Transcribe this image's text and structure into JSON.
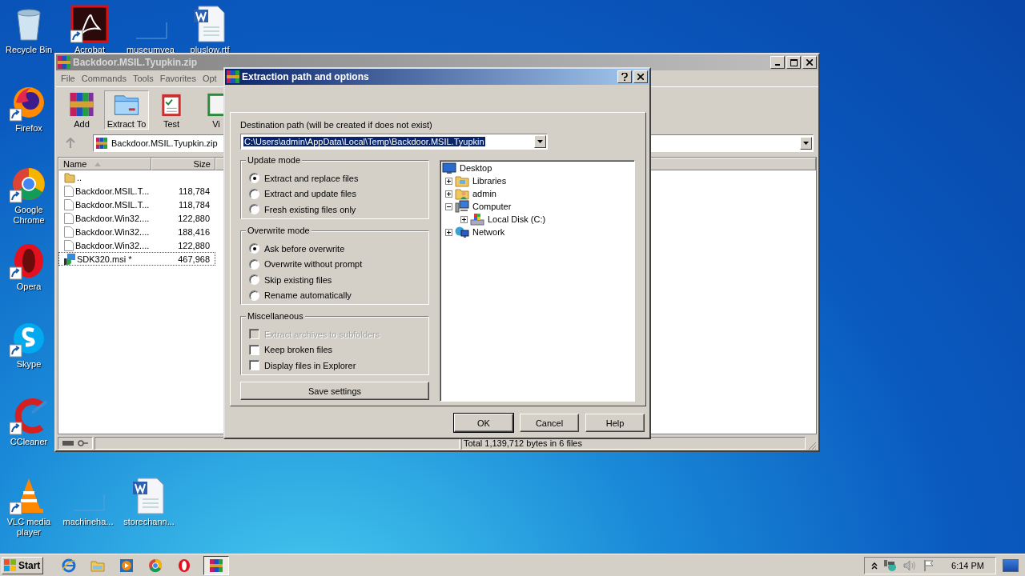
{
  "desktop_icons": [
    {
      "label": "Recycle Bin",
      "shortcut": false
    },
    {
      "label": "Acrobat",
      "shortcut": true
    },
    {
      "label": "museumvea",
      "shortcut": false
    },
    {
      "label": "pluslow.rtf",
      "shortcut": false
    },
    {
      "label": "Firefox",
      "shortcut": true
    },
    {
      "label": "Google Chrome",
      "shortcut": true
    },
    {
      "label": "Opera",
      "shortcut": true
    },
    {
      "label": "Skype",
      "shortcut": true
    },
    {
      "label": "CCleaner",
      "shortcut": true
    },
    {
      "label": "VLC media player",
      "shortcut": true
    },
    {
      "label": "machineha...",
      "shortcut": false
    },
    {
      "label": "storechann...",
      "shortcut": false
    }
  ],
  "archive_window": {
    "title": "Backdoor.MSIL.Tyupkin.zip",
    "menu": [
      "File",
      "Commands",
      "Tools",
      "Favorites",
      "Opt"
    ],
    "toolbar": [
      {
        "label": "Add",
        "selected": false
      },
      {
        "label": "Extract To",
        "selected": true
      },
      {
        "label": "Test",
        "selected": false
      },
      {
        "label": "Vi",
        "selected": false
      }
    ],
    "address": "Backdoor.MSIL.Tyupkin.zip",
    "columns": [
      "Name",
      "Size"
    ],
    "files": [
      {
        "kind": "folder",
        "name": "..",
        "focused": false
      },
      {
        "kind": "file",
        "name": "Backdoor.MSIL.T...",
        "size": "118,784",
        "focused": false
      },
      {
        "kind": "file",
        "name": "Backdoor.MSIL.T...",
        "size": "118,784",
        "focused": false
      },
      {
        "kind": "file",
        "name": "Backdoor.Win32....",
        "size": "122,880",
        "focused": false
      },
      {
        "kind": "file",
        "name": "Backdoor.Win32....",
        "size": "188,416",
        "focused": false
      },
      {
        "kind": "file",
        "name": "Backdoor.Win32....",
        "size": "122,880",
        "focused": false
      },
      {
        "kind": "installer",
        "name": "SDK320.msi *",
        "size": "467,968",
        "focused": true
      }
    ],
    "status_bar": "Total 1,139,712 bytes in 6 files"
  },
  "dialog": {
    "title": "Extraction path and options",
    "destination_label": "Destination path (will be created if does not exist)",
    "destination_value": "C:\\Users\\admin\\AppData\\Local\\Temp\\Backdoor.MSIL.Tyupkin",
    "update_mode": {
      "title": "Update mode",
      "options": [
        {
          "label": "Extract and replace files",
          "selected": true
        },
        {
          "label": "Extract and update files",
          "selected": false
        },
        {
          "label": "Fresh existing files only",
          "selected": false
        }
      ]
    },
    "overwrite_mode": {
      "title": "Overwrite mode",
      "options": [
        {
          "label": "Ask before overwrite",
          "selected": true
        },
        {
          "label": "Overwrite without prompt",
          "selected": false
        },
        {
          "label": "Skip existing files",
          "selected": false
        },
        {
          "label": "Rename automatically",
          "selected": false
        }
      ]
    },
    "miscellaneous": {
      "title": "Miscellaneous",
      "options": [
        {
          "label": "Extract archives to subfolders",
          "checked": false,
          "disabled": true
        },
        {
          "label": "Keep broken files",
          "checked": false,
          "disabled": false
        },
        {
          "label": "Display files in Explorer",
          "checked": false,
          "disabled": false
        }
      ]
    },
    "save_button": "Save settings",
    "tree": [
      {
        "label": "Desktop",
        "kind": "desktop",
        "children": [
          {
            "label": "Libraries",
            "kind": "libraries",
            "expanded": false
          },
          {
            "label": "admin",
            "kind": "user",
            "expanded": false
          },
          {
            "label": "Computer",
            "kind": "computer",
            "expanded": true,
            "children": [
              {
                "label": "Local Disk (C:)",
                "kind": "disk",
                "expanded": false
              }
            ]
          },
          {
            "label": "Network",
            "kind": "network",
            "expanded": false
          }
        ]
      }
    ],
    "buttons": [
      "OK",
      "Cancel",
      "Help"
    ]
  },
  "taskbar": {
    "start": "Start",
    "clock": "6:14 PM",
    "apps": [
      {
        "selected": false
      },
      {
        "selected": false
      },
      {
        "selected": false
      },
      {
        "selected": false
      },
      {
        "selected": false
      },
      {
        "selected": true
      }
    ]
  }
}
